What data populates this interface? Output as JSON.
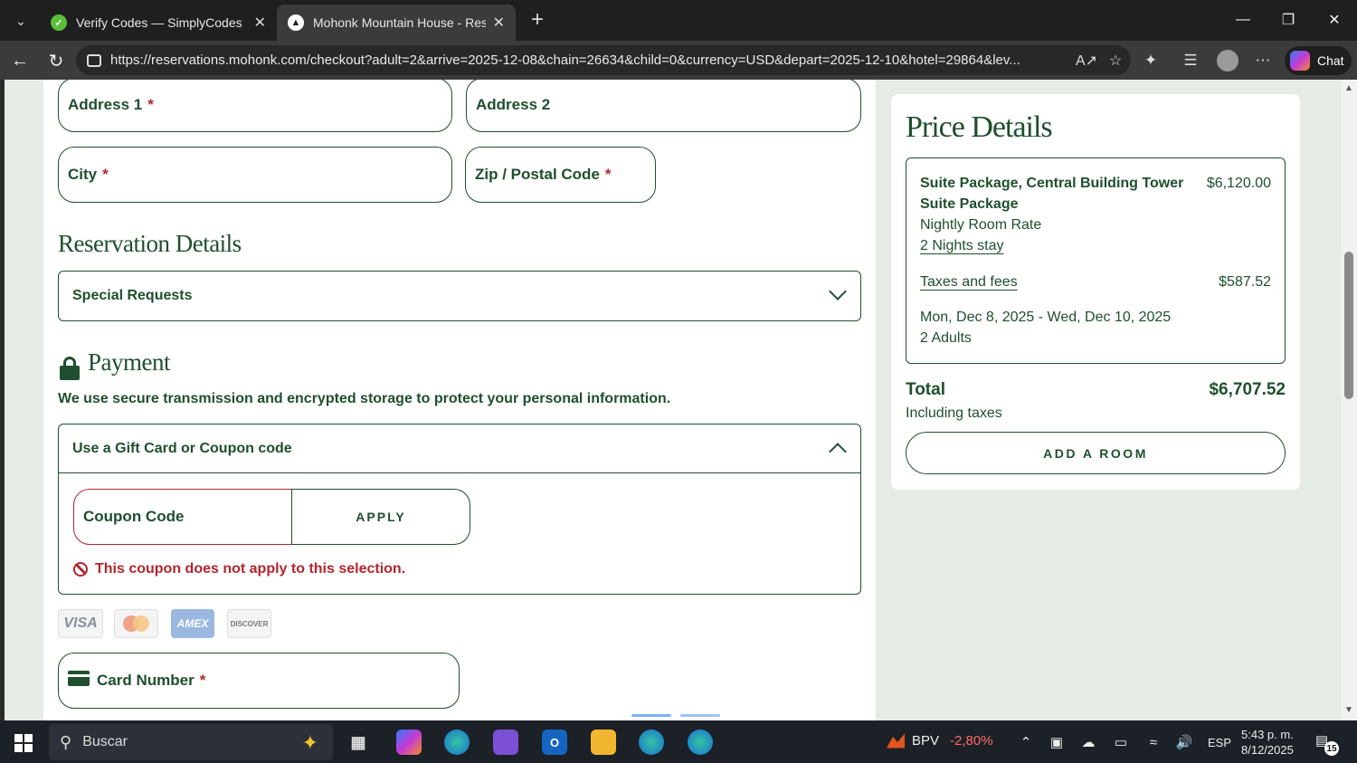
{
  "browser": {
    "tabs": [
      {
        "title": "Verify Codes — SimplyCodes",
        "favicon": "simplycodes-icon"
      },
      {
        "title": "Mohonk Mountain House - Reserv",
        "favicon": "mohonk-icon",
        "active": true
      }
    ],
    "url": "https://reservations.mohonk.com/checkout?adult=2&arrive=2025-12-08&chain=26634&child=0&currency=USD&depart=2025-12-10&hotel=29864&lev...",
    "chat_label": "Chat"
  },
  "form": {
    "address1": {
      "label": "Address 1",
      "required": "*"
    },
    "address2": {
      "label": "Address 2"
    },
    "city": {
      "label": "City",
      "required": "*"
    },
    "zip": {
      "label": "Zip / Postal Code",
      "required": "*"
    },
    "reservation_title": "Reservation Details",
    "special_requests": "Special Requests",
    "payment_title": "Payment",
    "secure_text": "We use secure transmission and encrypted storage to protect your personal information.",
    "gift_card": {
      "title": "Use a Gift Card or Coupon code",
      "coupon_placeholder": "Coupon Code",
      "apply_label": "APPLY",
      "error": "This coupon does not apply to this selection."
    },
    "card_logos": {
      "visa": "VISA",
      "amex": "AMEX",
      "discover": "DISCOVER"
    },
    "card_number": {
      "label": "Card Number",
      "required": "*"
    }
  },
  "price": {
    "title": "Price Details",
    "package_line1": "Suite Package, Central Building Tower",
    "package_line2": "Suite Package",
    "package_price": "$6,120.00",
    "rate_label": "Nightly Room Rate",
    "nights": "2 Nights stay",
    "taxes_label": "Taxes and fees",
    "taxes_value": "$587.52",
    "dates": "Mon, Dec 8, 2025 - Wed, Dec 10, 2025",
    "guests": "2 Adults",
    "total_label": "Total",
    "total_value": "$6,707.52",
    "including_taxes": "Including taxes",
    "add_room": "ADD A ROOM"
  },
  "taskbar": {
    "search_placeholder": "Buscar",
    "stock_symbol": "BPV",
    "stock_change": "-2,80%",
    "language": "ESP",
    "time": "5:43 p. m.",
    "date": "8/12/2025",
    "notification_count": "15"
  }
}
